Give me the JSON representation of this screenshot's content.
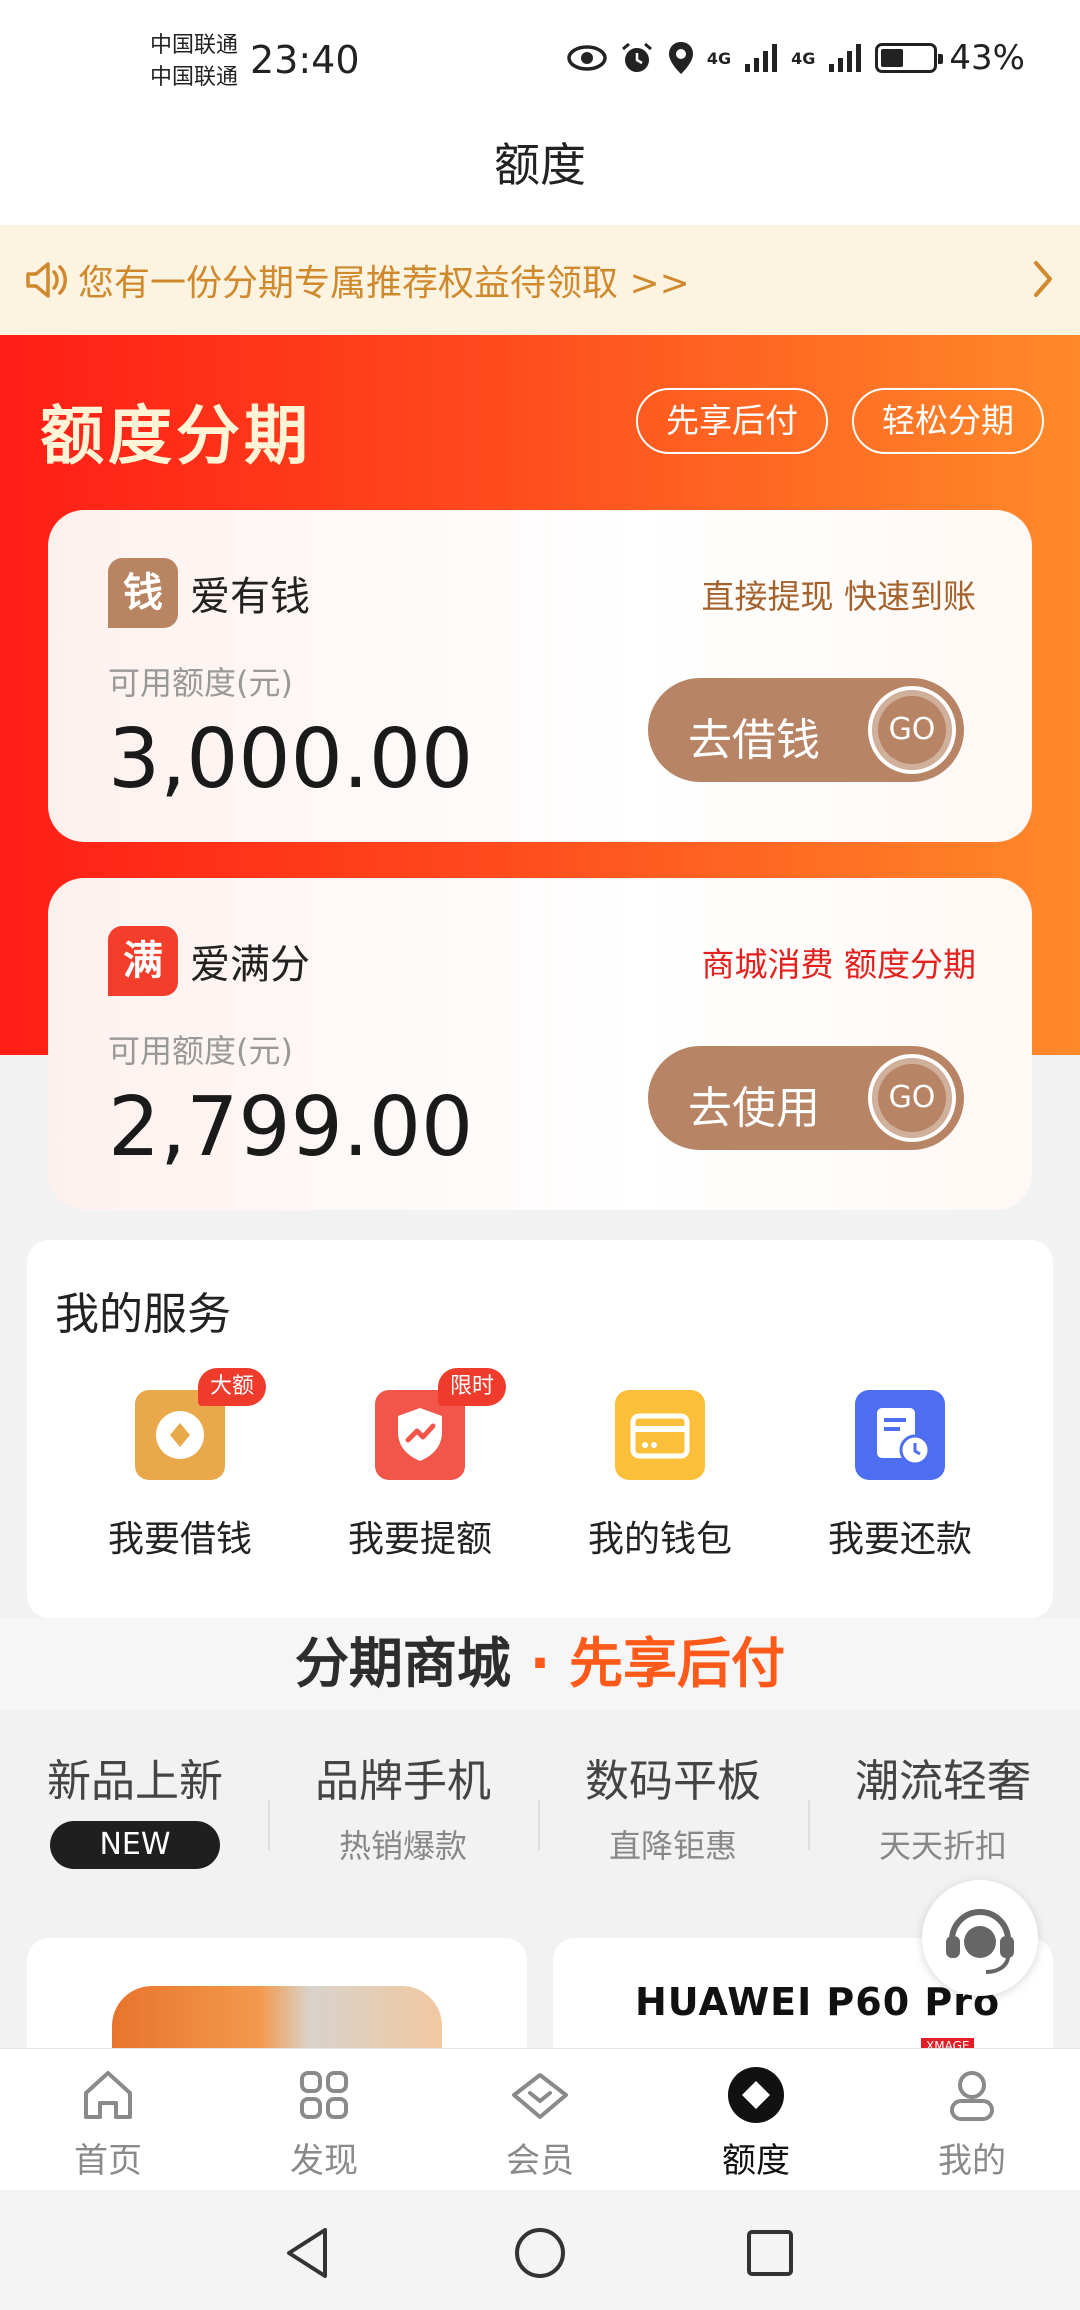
{
  "status_bar": {
    "carrier_1": "中国联通",
    "carrier_2": "中国联通",
    "time": "23:40",
    "net_1": "4G",
    "net_2": "4G",
    "battery_percent": "43%",
    "battery_level": 0.43
  },
  "header": {
    "title": "额度"
  },
  "notice": {
    "text": "您有一份分期专属推荐权益待领取 >>"
  },
  "hero": {
    "title": "额度分期",
    "pills": [
      "先享后付",
      "轻松分期"
    ]
  },
  "cards": [
    {
      "logo": "钱",
      "name": "爱有钱",
      "tagline": "直接提现 快速到账",
      "label": "可用额度(元)",
      "amount": "3,000.00",
      "action": "去借钱",
      "go": "GO"
    },
    {
      "logo": "满",
      "name": "爱满分",
      "tagline": "商城消费 额度分期",
      "label": "可用额度(元)",
      "amount": "2,799.00",
      "action": "去使用",
      "go": "GO"
    }
  ],
  "services": {
    "title": "我的服务",
    "items": [
      {
        "label": "我要借钱",
        "badge": "大额",
        "icon": "coin-icon"
      },
      {
        "label": "我要提额",
        "badge": "限时",
        "icon": "shield-up-icon"
      },
      {
        "label": "我的钱包",
        "badge": "",
        "icon": "wallet-icon"
      },
      {
        "label": "我要还款",
        "badge": "",
        "icon": "bill-clock-icon"
      }
    ]
  },
  "mall_banner": {
    "part_1": "分期商城",
    "part_2": "· 先享后付"
  },
  "categories": [
    {
      "title": "新品上新",
      "sub": "NEW"
    },
    {
      "title": "品牌手机",
      "sub": "热销爆款"
    },
    {
      "title": "数码平板",
      "sub": "直降钜惠"
    },
    {
      "title": "潮流轻奢",
      "sub": "天天折扣"
    }
  ],
  "products": [
    {
      "brand": ""
    },
    {
      "brand": "HUAWEI P60 Pro",
      "tag": "XMAGE"
    }
  ],
  "bottom_nav": [
    {
      "label": "首页",
      "icon": "home-icon"
    },
    {
      "label": "发现",
      "icon": "grid-icon"
    },
    {
      "label": "会员",
      "icon": "diamond-icon"
    },
    {
      "label": "额度",
      "icon": "quota-icon",
      "active": true
    },
    {
      "label": "我的",
      "icon": "user-icon"
    }
  ],
  "colors": {
    "accent": "#ff3a1c",
    "brown": "#b78466",
    "notice_text": "#d08a2e",
    "mall_orange": "#ff5a1a"
  }
}
